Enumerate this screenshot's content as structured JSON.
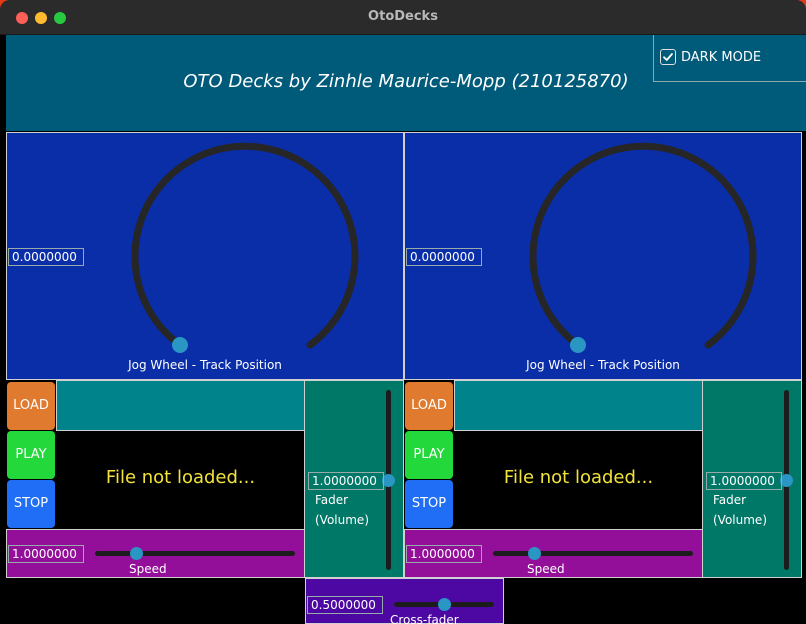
{
  "window": {
    "title": "OtoDecks"
  },
  "header": {
    "title": "OTO Decks by Zinhle Maurice-Mopp (210125870)",
    "dark_mode_label": "DARK MODE",
    "dark_mode_checked": true
  },
  "decks": [
    {
      "position_value": "0.0000000",
      "jog_label": "Jog Wheel - Track Position",
      "load_label": "LOAD",
      "play_label": "PLAY",
      "stop_label": "STOP",
      "waveform_text": "File not loaded...",
      "volume_value": "1.0000000",
      "volume_label_1": "Fader",
      "volume_label_2": "(Volume)",
      "speed_value": "1.0000000",
      "speed_label": "Speed"
    },
    {
      "position_value": "0.0000000",
      "jog_label": "Jog Wheel - Track Position",
      "load_label": "LOAD",
      "play_label": "PLAY",
      "stop_label": "STOP",
      "waveform_text": "File not loaded...",
      "volume_value": "1.0000000",
      "volume_label_1": "Fader",
      "volume_label_2": "(Volume)",
      "speed_value": "1.0000000",
      "speed_label": "Speed"
    }
  ],
  "crossfader": {
    "value": "0.5000000",
    "label": "Cross-fader"
  },
  "colors": {
    "header": "#005a7a",
    "jog_panel": "#0a2da8",
    "load": "#e07a2e",
    "play": "#22d83a",
    "stop": "#1f6ef5",
    "fader": "#007868",
    "speed": "#930f9a",
    "crossfader": "#4d08a4",
    "waveform_text": "#f2e23a",
    "knob": "#2a96c4"
  },
  "icons": {
    "checkbox": "checkmark-icon"
  }
}
